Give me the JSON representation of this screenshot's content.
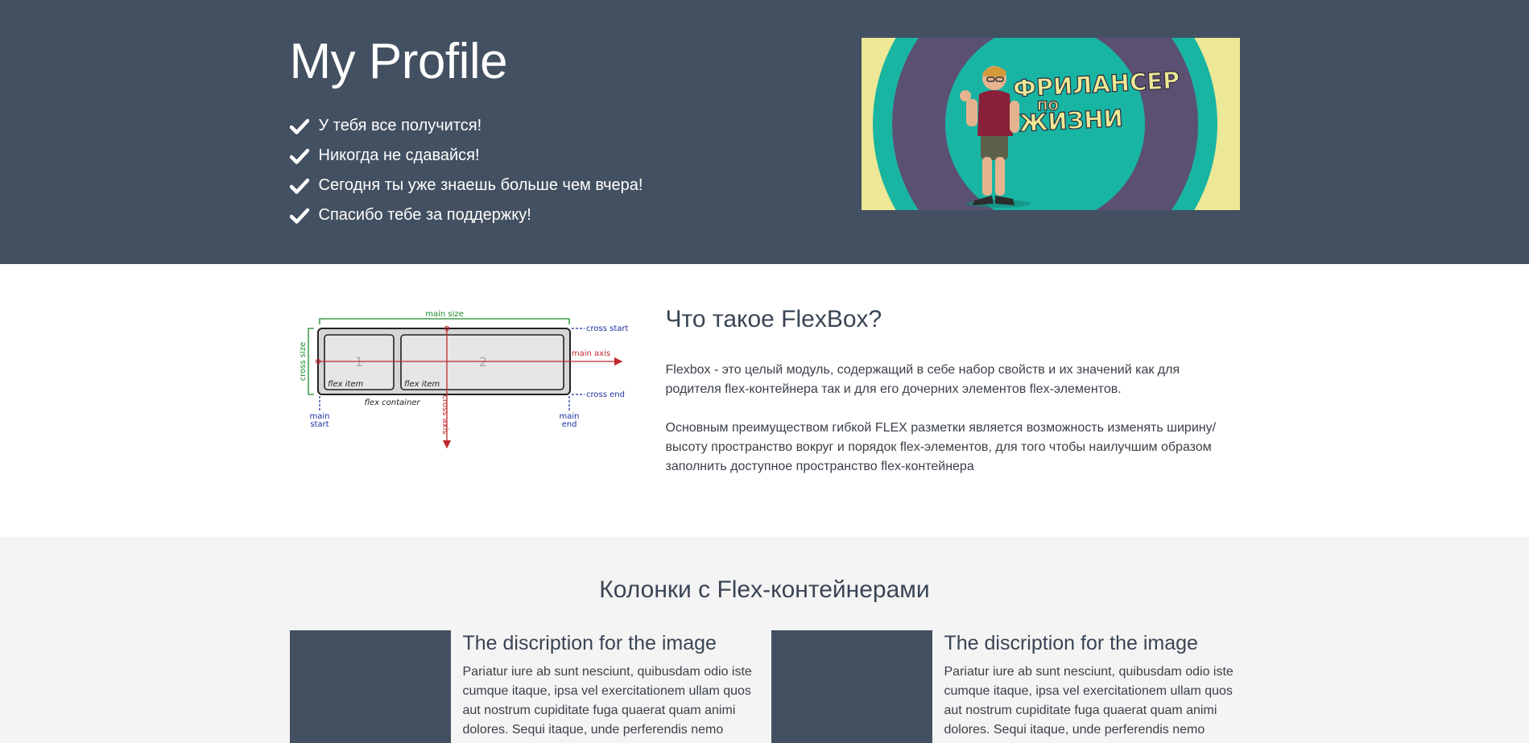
{
  "hero": {
    "title": "My Profile",
    "bullets": [
      "У тебя все получится!",
      "Никогда не сдавайся!",
      "Сегодня ты уже знаешь больше чем вчера!",
      "Спасибо тебе за поддержку!"
    ],
    "image": {
      "logo_line1": "ФРИЛАНСЕР",
      "logo_line2": "ПО",
      "logo_line3": "ЖИЗНИ"
    }
  },
  "about": {
    "diagram": {
      "main_size": "main size",
      "cross_start": "cross start",
      "cross_end": "cross end",
      "main_axis": "main axis",
      "cross_axis": "cross axis",
      "cross_size": "cross size",
      "item1_num": "1",
      "item2_num": "2",
      "flex_item": "flex item",
      "flex_container": "flex container",
      "main_start_1": "main",
      "main_start_2": "start",
      "main_end_1": "main",
      "main_end_2": "end"
    },
    "title": "Что такое FlexBox?",
    "paragraph1_line1": "Flexbox - это целый модуль, содержащий в себе набор свойств и их значений как для",
    "paragraph1_line2": "родителя flex-контейнера так и для его дочерних элементов flex-элементов.",
    "paragraph2_line1": "Основным преимуществом гибкой FLEX разметки является возможность изменять ширину/",
    "paragraph2_line2": "высоту пространство вокруг и порядок flex-элементов, для того чтобы наилучшим образом",
    "paragraph2_line3": "заполнить доступное пространство flex-контейнера"
  },
  "columns": {
    "title": "Колонки с Flex-контейнерами",
    "cards": [
      {
        "heading": "The discription for the image",
        "text": "Pariatur iure ab sunt nesciunt, quibusdam odio iste cumque itaque, ipsa vel exercitationem ullam quos aut nostrum cupiditate fuga quaerat quam animi dolores. Sequi itaque, unde perferendis nemo"
      },
      {
        "heading": "The discription for the image",
        "text": "Pariatur iure ab sunt nesciunt, quibusdam odio iste cumque itaque, ipsa vel exercitationem ullam quos aut nostrum cupiditate fuga quaerat quam animi dolores. Sequi itaque, unde perferendis nemo"
      }
    ]
  },
  "colors": {
    "hero_bg": "#435061",
    "section_bg": "#f4f4f4",
    "heading_text": "#3a4555",
    "image_teal": "#19b5a3",
    "image_purple": "#5b5072",
    "image_yellow": "#ece895"
  }
}
